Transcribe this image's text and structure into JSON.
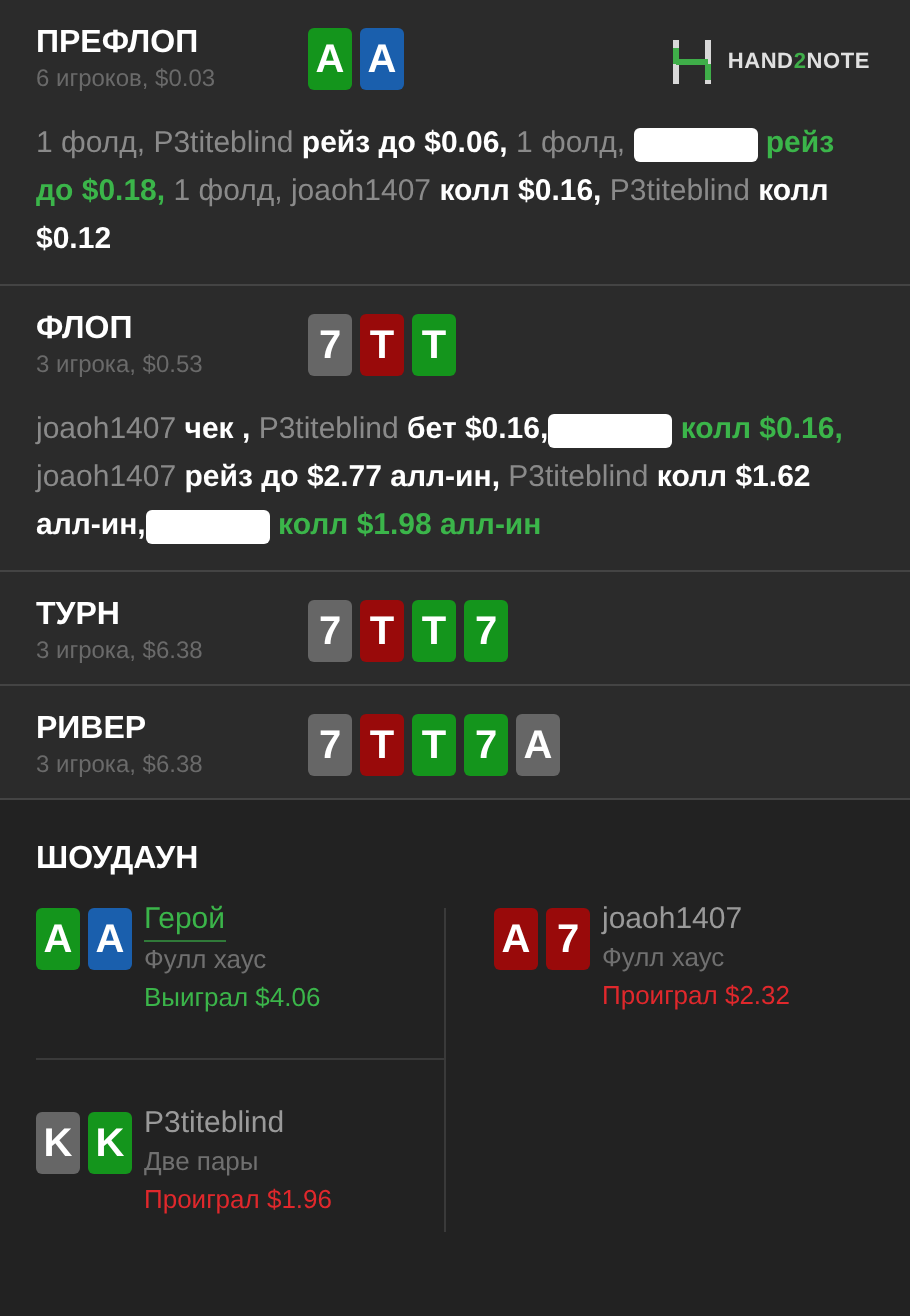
{
  "logo": {
    "parts": [
      {
        "text": "HAND",
        "kind": "plain"
      },
      {
        "text": "2",
        "kind": "accent"
      },
      {
        "text": "NOTE",
        "kind": "plain"
      }
    ]
  },
  "streets": [
    {
      "title": "ПРЕФЛОП",
      "subtitle": "6 игроков, $0.03",
      "cards": [
        {
          "rank": "A",
          "color": "#14951c"
        },
        {
          "rank": "A",
          "color": "#1a5fad"
        }
      ],
      "actions": [
        {
          "text": "1 фолд, P3titeblind ",
          "kind": "player"
        },
        {
          "text": "рейз до $0.06, ",
          "kind": "action"
        },
        {
          "text": "1 фолд, ",
          "kind": "player"
        },
        {
          "kind": "redacted"
        },
        {
          "text": " рейз до $0.18, ",
          "kind": "hero"
        },
        {
          "text": "1 фолд, joaoh1407 ",
          "kind": "player"
        },
        {
          "text": "колл $0.16, ",
          "kind": "action"
        },
        {
          "text": "P3titeblind ",
          "kind": "player"
        },
        {
          "text": "колл $0.12",
          "kind": "action"
        }
      ]
    },
    {
      "title": "ФЛОП",
      "subtitle": "3 игрока, $0.53",
      "cards": [
        {
          "rank": "7",
          "color": "#666666"
        },
        {
          "rank": "T",
          "color": "#990a0a"
        },
        {
          "rank": "T",
          "color": "#14951c"
        }
      ],
      "actions": [
        {
          "text": "joaoh1407 ",
          "kind": "player"
        },
        {
          "text": "чек , ",
          "kind": "action"
        },
        {
          "text": "P3titeblind ",
          "kind": "player"
        },
        {
          "text": "бет $0.16,",
          "kind": "action"
        },
        {
          "kind": "redacted"
        },
        {
          "text": " колл $0.16, ",
          "kind": "hero"
        },
        {
          "text": "joaoh1407 ",
          "kind": "player"
        },
        {
          "text": "рейз до $2.77 алл-ин, ",
          "kind": "action"
        },
        {
          "text": "P3titeblind ",
          "kind": "player"
        },
        {
          "text": "колл $1.62 алл-ин,",
          "kind": "action"
        },
        {
          "kind": "redacted"
        },
        {
          "text": " колл $1.98 алл-ин",
          "kind": "hero"
        }
      ]
    },
    {
      "title": "ТУРН",
      "subtitle": "3 игрока, $6.38",
      "cards": [
        {
          "rank": "7",
          "color": "#666666"
        },
        {
          "rank": "T",
          "color": "#990a0a"
        },
        {
          "rank": "T",
          "color": "#14951c"
        },
        {
          "rank": "7",
          "color": "#14951c"
        }
      ]
    },
    {
      "title": "РИВЕР",
      "subtitle": "3 игрока, $6.38",
      "cards": [
        {
          "rank": "7",
          "color": "#666666"
        },
        {
          "rank": "T",
          "color": "#990a0a"
        },
        {
          "rank": "T",
          "color": "#14951c"
        },
        {
          "rank": "7",
          "color": "#14951c"
        },
        {
          "rank": "A",
          "color": "#666666"
        }
      ]
    }
  ],
  "showdown": {
    "title": "ШОУДАУН",
    "players": [
      {
        "name": "Герой",
        "hero": true,
        "hand": "Фулл хаус",
        "result": "Выиграл $4.06",
        "kind": "won",
        "cards": [
          {
            "rank": "A",
            "color": "#14951c"
          },
          {
            "rank": "A",
            "color": "#1a5fad"
          }
        ]
      },
      {
        "name": "joaoh1407",
        "hero": false,
        "hand": "Фулл хаус",
        "result": "Проиграл $2.32",
        "kind": "lost",
        "cards": [
          {
            "rank": "A",
            "color": "#990a0a"
          },
          {
            "rank": "7",
            "color": "#990a0a"
          }
        ]
      },
      {
        "name": "P3titeblind",
        "hero": false,
        "hand": "Две пары",
        "result": "Проиграл $1.96",
        "kind": "lost",
        "cards": [
          {
            "rank": "K",
            "color": "#666666"
          },
          {
            "rank": "K",
            "color": "#14951c"
          }
        ]
      }
    ]
  }
}
